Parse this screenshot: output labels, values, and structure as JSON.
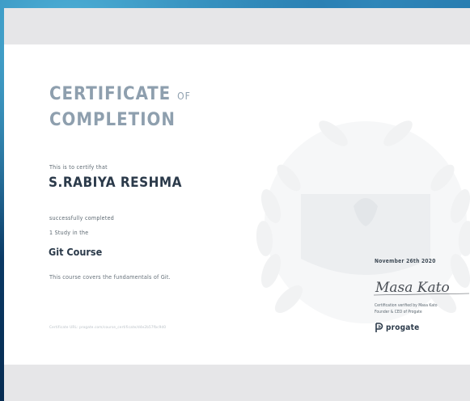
{
  "certificate": {
    "title_line1": "CERTIFICATE",
    "title_of": "OF",
    "title_line2": "COMPLETION",
    "intro": "This is to certify that",
    "recipient": "S.RABIYA RESHMA",
    "completed_label": "successfully completed",
    "study_count": "1 Study",
    "study_suffix": "in the",
    "course_name": "Git Course",
    "course_description": "This course covers the fundamentals of Git.",
    "certificate_url": "Certificate URL: progate.com/course_certificate/d4e2b57fbc9d0",
    "date": "November 26th 2020",
    "signature_text": "Masa Kato",
    "verified_line1": "Certification verified by Masa Kato",
    "verified_line2": "Founder & CEO of Progate",
    "brand": "progate"
  },
  "colors": {
    "title": "#8e9fae",
    "text_dark": "#2b3a4a",
    "page_bg": "#e6e6e8",
    "backdrop": "#0b3f6b"
  }
}
